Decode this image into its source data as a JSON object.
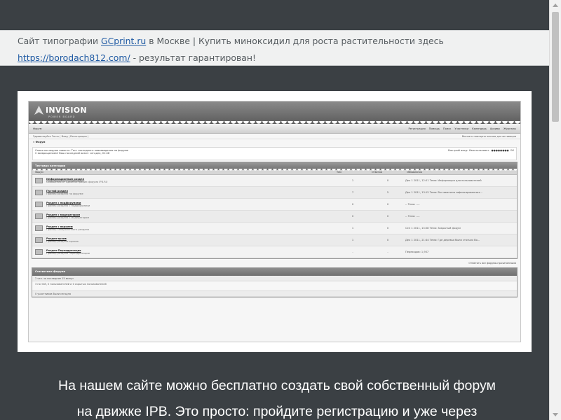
{
  "ad": {
    "text_1": "Сайт типографии ",
    "link_1": "GCprint.ru",
    "text_2": " в Москве | Купить миноксидил для роста растительности здесь ",
    "link_2": "https://borodach812.com/",
    "text_3": " - результат гарантирован!"
  },
  "forum": {
    "logo": "INVISION",
    "logo_sub": "POWER BOARD",
    "nav_left": "Форум",
    "nav_links": [
      "Регистрация",
      "Помощь",
      "Поиск",
      "Участники",
      "Календарь",
      "Архивы",
      "Журналы"
    ],
    "sub_left": "Здравствуйте Гость ( Вход | Регистрация )",
    "sub_right": "Выслать повторно письмо для активации",
    "crumb": "Форум",
    "news_title": "Самая последняя новость: Тест последнего нововведения на форуме",
    "news_sub": "С возвращением! Ваш последний визит: сегодня, 01:48",
    "login_label": "Быстрый вход:",
    "login_value": "Имя пользоват.",
    "login_pass": "●●●●●●●●",
    "login_btn": "ОК",
    "category": "Тестовая категория",
    "cols": [
      "Форум",
      "Тем",
      "Ответов",
      "Обновления"
    ],
    "rows": [
      {
        "name": "Информационный раздел",
        "desc": "Сообщения от Администрации форума IPB.RU",
        "topics": "1",
        "replies": "0",
        "last": "Дек 1 2011, 12:01 Тема: Информация для пользователей"
      },
      {
        "name": "Пустой раздел",
        "desc": "Пример раздела на форуме",
        "topics": "7",
        "replies": "5",
        "last": "Дек 1 2011, 13:15 Тема: Вы заметили зафиксированных..."
      },
      {
        "name": "Раздел с подфорумами",
        "desc": "Пример раздела с подфорумами",
        "topics": "0",
        "replies": "0",
        "last": "-- Тема: ----"
      },
      {
        "name": "Раздел с модератором",
        "desc": "Пример раздела с модератором",
        "topics": "0",
        "replies": "0",
        "last": "-- Тема: ----"
      },
      {
        "name": "Раздел с паролем",
        "desc": "Пример запароленного раздела",
        "topics": "1",
        "replies": "0",
        "last": "Сен 1 2011, 13:08 Тема: Закрытый форум"
      },
      {
        "name": "Раздел-архив",
        "desc": "Пример раздела-архива",
        "topics": "1",
        "replies": "0",
        "last": "Дек 1 2011, 21:44 Тема: Где деревья были стоячих Во..."
      },
      {
        "name": "Раздел-Переадресация",
        "desc": "Пример раздела переадресации",
        "topics": "-",
        "replies": "-",
        "last": "Переходов: 1,937"
      }
    ],
    "foot": "Отметить все форумы прочитанными",
    "stats_title": "Статистика форума",
    "stats_line1": "2 чел. за последние 15 минут",
    "stats_line2": "3 гостей, 0 пользователей и 0 скрытых пользователей",
    "stats_line3": "0 участников были сегодня"
  },
  "lead": {
    "line_1": "На нашем сайте можно бесплатно создать свой собственный форум",
    "line_2": "на движке IPB. Это просто: пройдите регистрацию и уже через"
  }
}
